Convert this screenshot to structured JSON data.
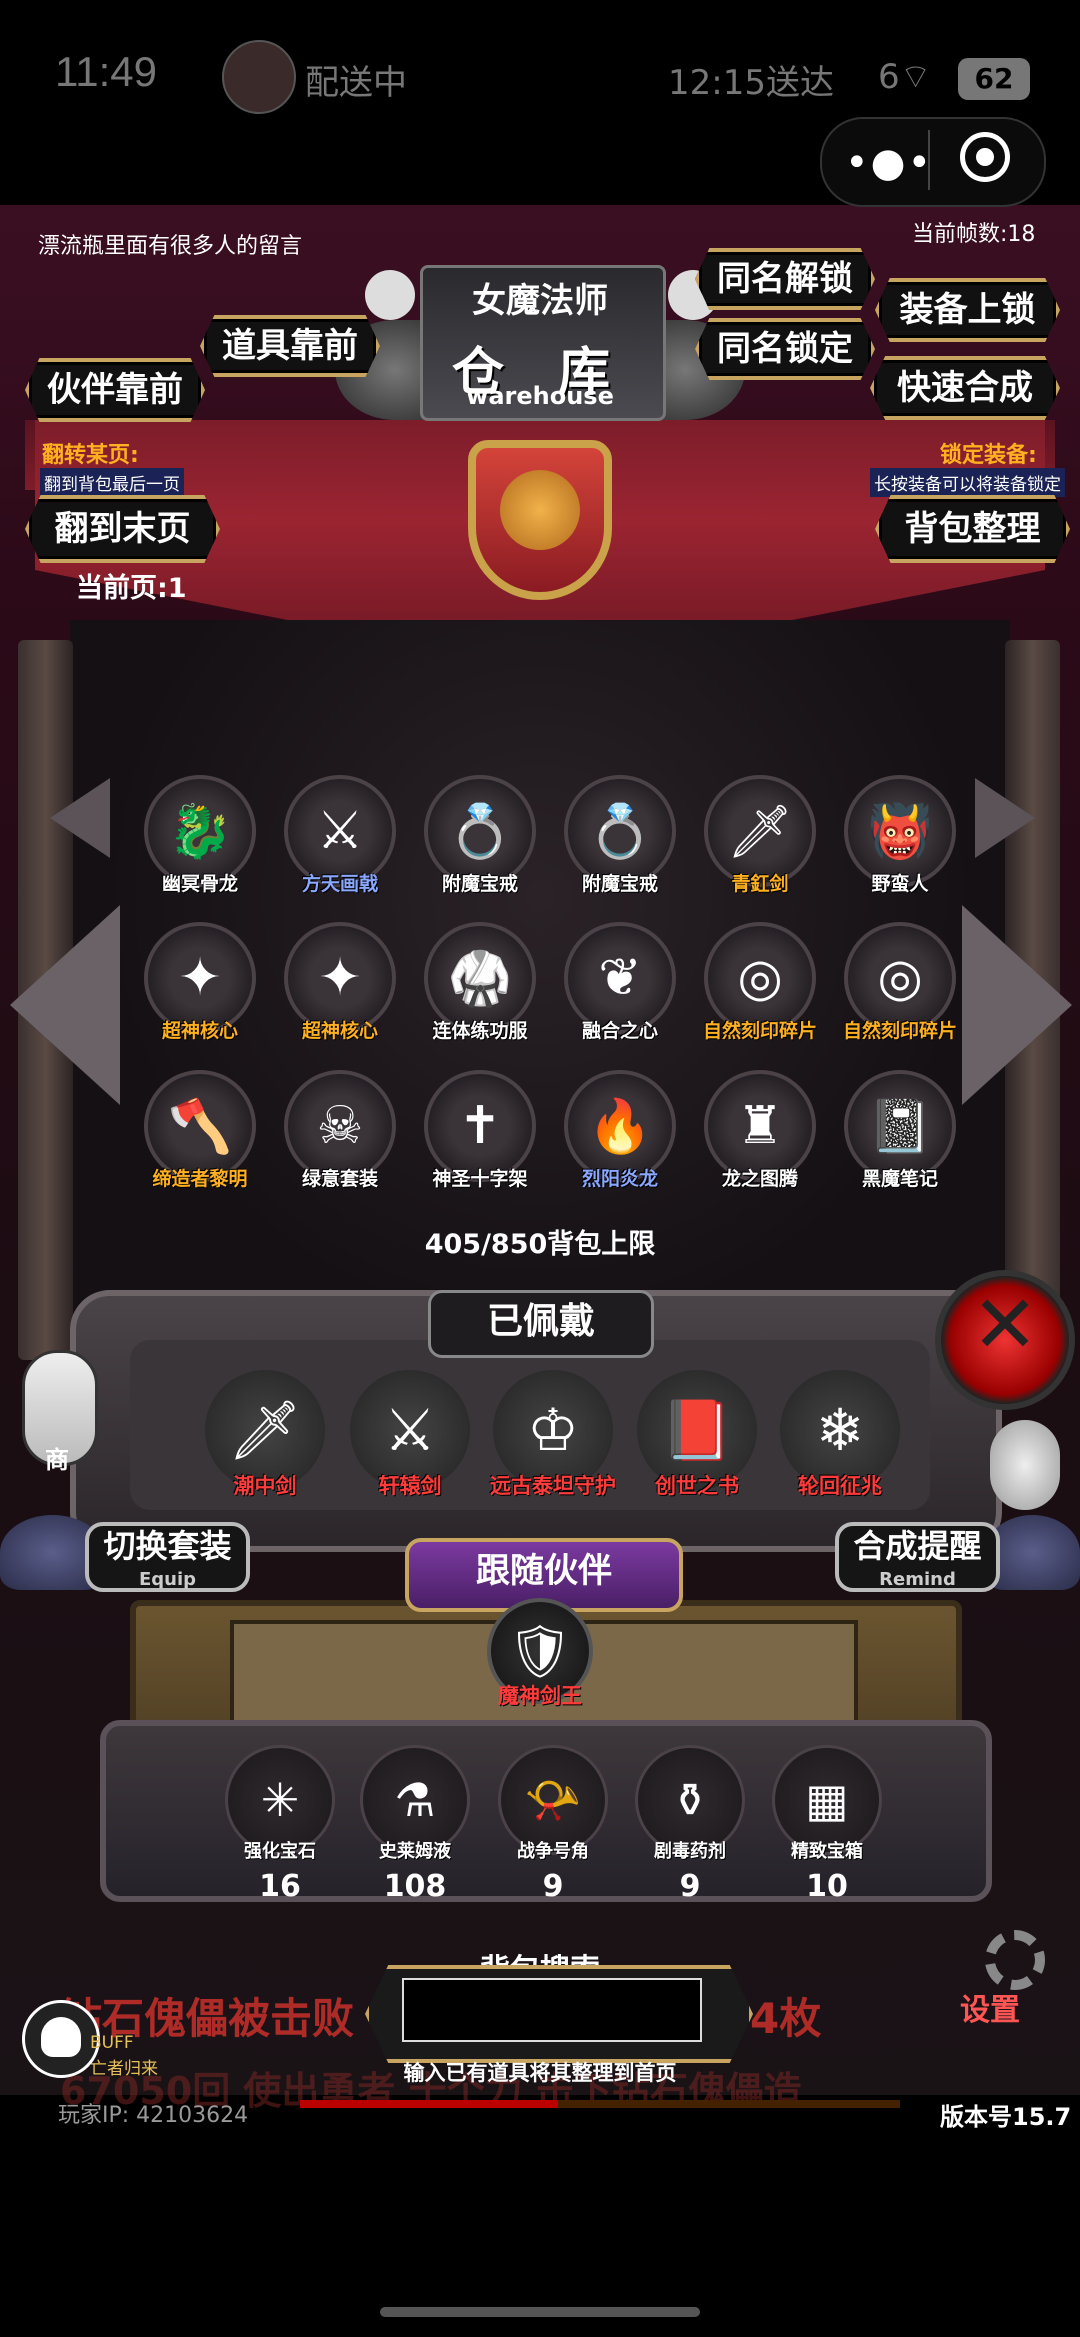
{
  "status_bar": {
    "time": "11:49",
    "delivery_status": "配送中",
    "delivery_eta": "12:15送达",
    "battery": "62",
    "signal": "6"
  },
  "capsule": {
    "more_icon": "more-dots-icon",
    "close_icon": "target-close-icon"
  },
  "header": {
    "hint": "漂流瓶里面有很多人的留言",
    "fps": "当前帧数:18",
    "class_name": "女魔法师",
    "warehouse_cn": "仓 库",
    "warehouse_en": "warehouse"
  },
  "buttons": {
    "same_name_unlock": "同名解锁",
    "same_name_lock": "同名锁定",
    "equip_unlock": "装备上锁",
    "quick_synth": "快速合成",
    "items_front": "道具靠前",
    "partner_front": "伙伴靠前",
    "to_last_page": "翻到末页",
    "bag_sort": "背包整理"
  },
  "left_note": {
    "title": "翻转某页:",
    "desc": "翻到背包最后一页"
  },
  "right_note": {
    "title": "锁定装备:",
    "desc": "长按装备可以将装备锁定"
  },
  "pager": "当前页:1",
  "grid": [
    {
      "name": "幽冥骨龙",
      "color": "#ffffff",
      "icon": "bone-dragon-icon"
    },
    {
      "name": "方天画戟",
      "color": "#8aa8ff",
      "icon": "halberd-icon"
    },
    {
      "name": "附魔宝戒",
      "color": "#ffffff",
      "icon": "ring-icon"
    },
    {
      "name": "附魔宝戒",
      "color": "#ffffff",
      "icon": "ring-icon"
    },
    {
      "name": "青釭剑",
      "color": "#ffb020",
      "icon": "sword-icon"
    },
    {
      "name": "野蛮人",
      "color": "#ffffff",
      "icon": "barbarian-icon"
    },
    {
      "name": "超神核心",
      "color": "#ffb020",
      "icon": "core-icon"
    },
    {
      "name": "超神核心",
      "color": "#ffb020",
      "icon": "core-icon"
    },
    {
      "name": "连体练功服",
      "color": "#ffffff",
      "icon": "training-suit-icon"
    },
    {
      "name": "融合之心",
      "color": "#ffffff",
      "icon": "fusion-heart-icon"
    },
    {
      "name": "自然刻印碎片",
      "color": "#ffb020",
      "icon": "rune-shard-icon"
    },
    {
      "name": "自然刻印碎片",
      "color": "#ffb020",
      "icon": "rune-shard-icon"
    },
    {
      "name": "缔造者黎明",
      "color": "#ffb020",
      "icon": "axe-icon"
    },
    {
      "name": "绿意套装",
      "color": "#ffffff",
      "icon": "green-armor-icon"
    },
    {
      "name": "神圣十字架",
      "color": "#ffffff",
      "icon": "holy-cross-icon"
    },
    {
      "name": "烈阳炎龙",
      "color": "#8aa8ff",
      "icon": "fire-dragon-icon"
    },
    {
      "name": "龙之图腾",
      "color": "#ffffff",
      "icon": "dragon-totem-icon"
    },
    {
      "name": "黑魔笔记",
      "color": "#ffffff",
      "icon": "dark-notebook-icon"
    }
  ],
  "capacity": "405/850背包上限",
  "worn": {
    "title": "已佩戴",
    "items": [
      {
        "name": "潮中剑",
        "icon": "tide-sword-icon"
      },
      {
        "name": "轩辕剑",
        "icon": "xuanyuan-sword-icon"
      },
      {
        "name": "远古泰坦守护",
        "icon": "titan-guard-icon"
      },
      {
        "name": "创世之书",
        "icon": "genesis-book-icon"
      },
      {
        "name": "轮回征兆",
        "icon": "reincarnation-staff-icon"
      }
    ]
  },
  "switch_set": {
    "label": "切换套装",
    "sub": "Equip"
  },
  "synth_remind": {
    "label": "合成提醒",
    "sub": "Remind"
  },
  "follow_partner": "跟随伙伴",
  "partner": {
    "name": "魔神剑王",
    "icon": "demon-sword-king-icon"
  },
  "consumables": [
    {
      "name": "强化宝石",
      "count": "16",
      "icon": "enhance-gem-icon"
    },
    {
      "name": "史莱姆液",
      "count": "108",
      "icon": "slime-potion-icon"
    },
    {
      "name": "战争号角",
      "count": "9",
      "icon": "war-horn-icon"
    },
    {
      "name": "剧毒药剂",
      "count": "9",
      "icon": "poison-flask-icon"
    },
    {
      "name": "精致宝箱",
      "count": "10",
      "icon": "treasure-chest-icon"
    }
  ],
  "shop_label": "商",
  "announce": {
    "line1_left": "钻石傀儡被击败",
    "line1_right": "4枚",
    "line2": "67050回 使出勇者 十个力 击下钻石傀儡造"
  },
  "search": {
    "label": "背包搜索",
    "placeholder": "",
    "hint": "输入已有道具将其整理到首页"
  },
  "settings_label": "设置",
  "buff": {
    "label": "BUFF",
    "sub": "亡者归来"
  },
  "player_ip": "玩家IP:   42103624",
  "load_progress": 0.43,
  "version": "版本号15.7"
}
